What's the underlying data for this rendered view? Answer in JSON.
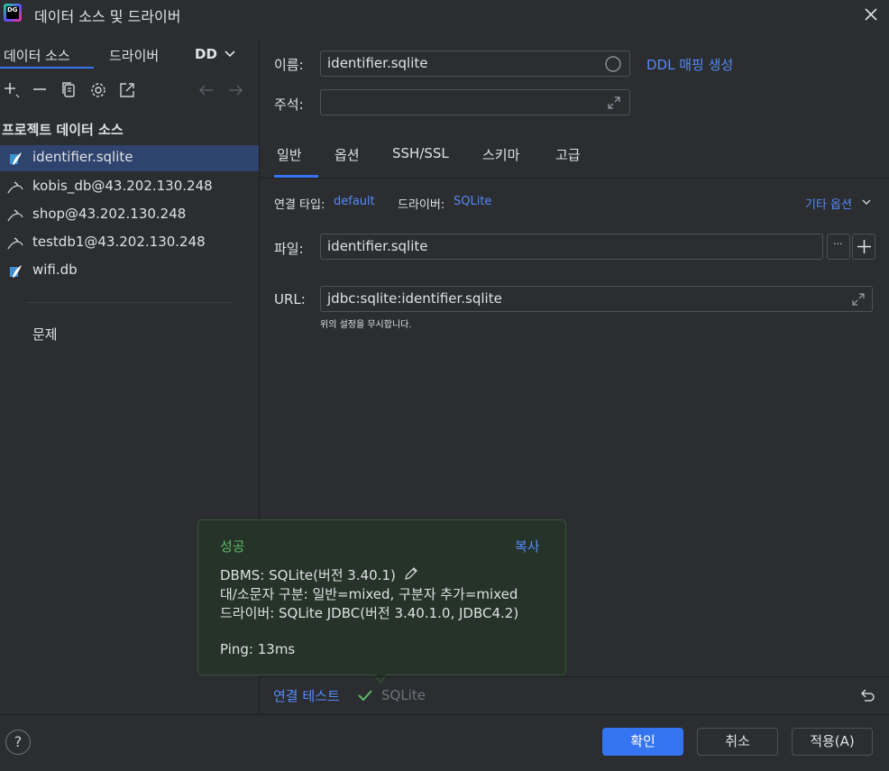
{
  "window": {
    "title": "데이터 소스 및 드라이버",
    "app_icon_text": "DG"
  },
  "left_tabs": [
    {
      "label": "데이터 소스"
    },
    {
      "label": "드라이버"
    },
    {
      "label": "DD"
    }
  ],
  "section_title": "프로젝트 데이터 소스",
  "data_sources": [
    {
      "label": "identifier.sqlite",
      "icon": "sqlite-icon"
    },
    {
      "label": "kobis_db@43.202.130.248",
      "icon": "mysql-icon"
    },
    {
      "label": "shop@43.202.130.248",
      "icon": "mysql-icon"
    },
    {
      "label": "testdb1@43.202.130.248",
      "icon": "mysql-icon"
    },
    {
      "label": "wifi.db",
      "icon": "sqlite-icon"
    }
  ],
  "problems_label": "문제",
  "form": {
    "name_label": "이름:",
    "name_value": "identifier.sqlite",
    "ddl_link": "DDL 매핑 생성",
    "comment_label": "주석:",
    "comment_value": ""
  },
  "right_tabs": [
    {
      "label": "일반"
    },
    {
      "label": "옵션"
    },
    {
      "label": "SSH/SSL"
    },
    {
      "label": "스키마"
    },
    {
      "label": "고급"
    }
  ],
  "connection": {
    "type_label": "연결 타입:",
    "type_value": "default",
    "driver_label": "드라이버:",
    "driver_value": "SQLite",
    "more_options": "기타 옵션",
    "file_label": "파일:",
    "file_value": "identifier.sqlite",
    "url_label": "URL:",
    "url_value": "jdbc:sqlite:identifier.sqlite",
    "url_hint": "위의 설정을 무시합니다."
  },
  "popup": {
    "status": "성공",
    "copy": "복사",
    "dbms": "DBMS: SQLite(버전 3.40.1)",
    "case": "대/소문자 구분: 일반=mixed, 구분자 추가=mixed",
    "driver": "드라이버: SQLite JDBC(버전 3.40.1.0, JDBC4.2)",
    "ping": "Ping: 13ms"
  },
  "test": {
    "label": "연결 테스트",
    "result": "SQLite"
  },
  "buttons": {
    "ok": "확인",
    "cancel": "취소",
    "apply": "적용(A)",
    "help": "?"
  },
  "colors": {
    "accent": "#3574f0",
    "link": "#548af7",
    "success": "#5fb865",
    "selection": "#2e436e"
  }
}
